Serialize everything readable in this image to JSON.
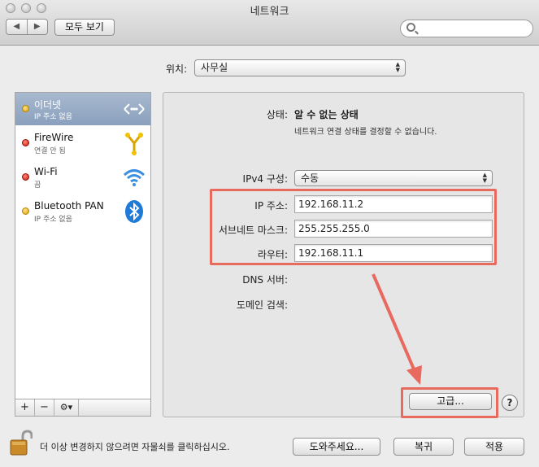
{
  "window": {
    "title": "네트워크"
  },
  "toolbar": {
    "back_forward": [
      "◀",
      "▶"
    ],
    "show_all_label": "모두 보기",
    "search_placeholder": ""
  },
  "location": {
    "label": "위치:",
    "value": "사무실"
  },
  "sidebar": {
    "items": [
      {
        "name": "이더넷",
        "status": "IP 주소 없음",
        "dot": "yellow",
        "selected": true,
        "icon": "ethernet-icon"
      },
      {
        "name": "FireWire",
        "status": "연결 안 됨",
        "dot": "red",
        "selected": false,
        "icon": "firewire-icon"
      },
      {
        "name": "Wi-Fi",
        "status": "끔",
        "dot": "red",
        "selected": false,
        "icon": "wifi-icon"
      },
      {
        "name": "Bluetooth PAN",
        "status": "IP 주소 없음",
        "dot": "yellow",
        "selected": false,
        "icon": "bluetooth-icon"
      }
    ],
    "controls": {
      "add": "+",
      "remove": "−",
      "action": "⚙▾"
    }
  },
  "detail": {
    "status_label": "상태:",
    "status_value": "알 수 없는 상태",
    "status_desc": "네트워크 연결 상태를 결정할 수 없습니다.",
    "ipv4_label": "IPv4 구성:",
    "ipv4_value": "수동",
    "ip_label": "IP 주소:",
    "ip_value": "192.168.11.2",
    "subnet_label": "서브네트 마스크:",
    "subnet_value": "255.255.255.0",
    "router_label": "라우터:",
    "router_value": "192.168.11.1",
    "dns_label": "DNS 서버:",
    "domain_label": "도메인 검색:",
    "advanced_label": "고급...",
    "help_label": "?"
  },
  "footer": {
    "lock_text": "더 이상 변경하지 않으려면 자물쇠를 클릭하십시오.",
    "assist_label": "도와주세요...",
    "revert_label": "복귀",
    "apply_label": "적용"
  },
  "colors": {
    "highlight": "#e86a5f",
    "selection": "#8aa0bd"
  }
}
